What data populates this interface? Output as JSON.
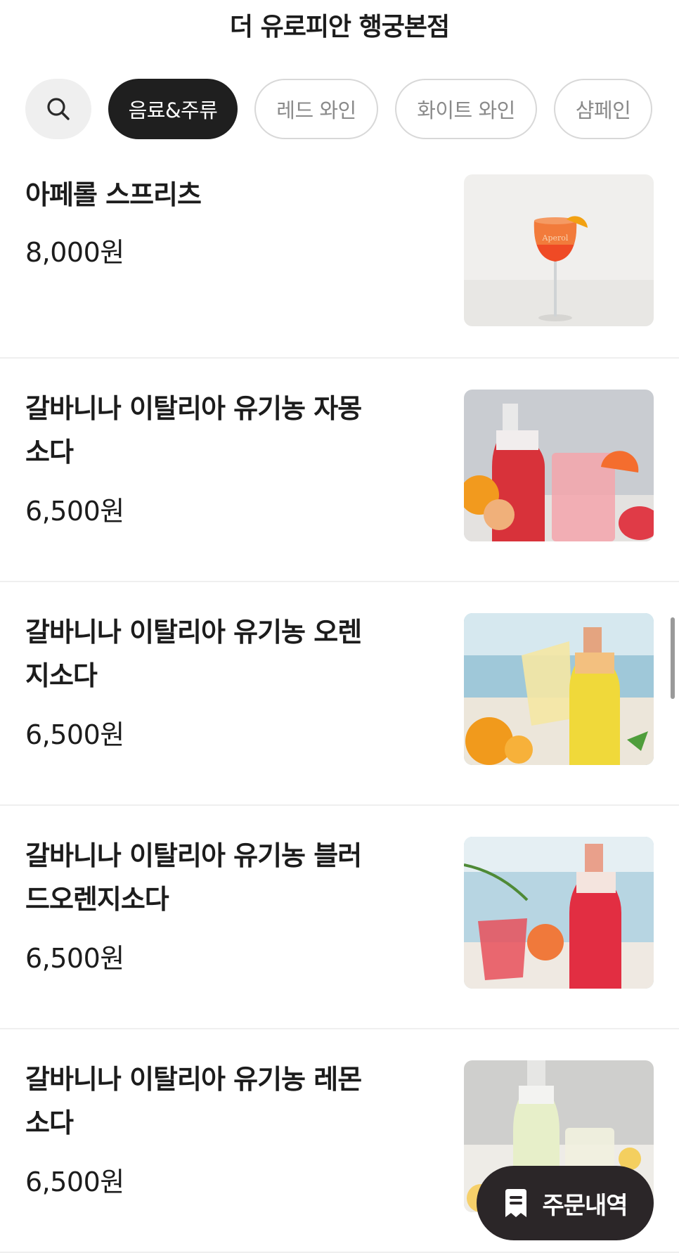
{
  "header": {
    "title": "더 유로피안 행궁본점"
  },
  "categories": {
    "search_icon": "search-icon",
    "items": [
      {
        "label": "음료&주류",
        "active": true
      },
      {
        "label": "레드 와인",
        "active": false
      },
      {
        "label": "화이트 와인",
        "active": false
      },
      {
        "label": "샴페인",
        "active": false
      }
    ]
  },
  "menu": {
    "items": [
      {
        "name": "아페롤 스프리츠",
        "price": "8,000원"
      },
      {
        "name": "갈바니나 이탈리아 유기농 자몽소다",
        "price": "6,500원"
      },
      {
        "name": "갈바니나 이탈리아 유기농 오렌지소다",
        "price": "6,500원"
      },
      {
        "name": "갈바니나 이탈리아 유기농 블러드오렌지소다",
        "price": "6,500원"
      },
      {
        "name": "갈바니나 이탈리아 유기농 레몬소다",
        "price": "6,500원"
      }
    ]
  },
  "order_history": {
    "label": "주문내역",
    "icon": "receipt-icon"
  },
  "colors": {
    "active_chip_bg": "#1f1f1f",
    "chip_border": "#d8d8d8",
    "order_button_bg": "#2b2628"
  }
}
